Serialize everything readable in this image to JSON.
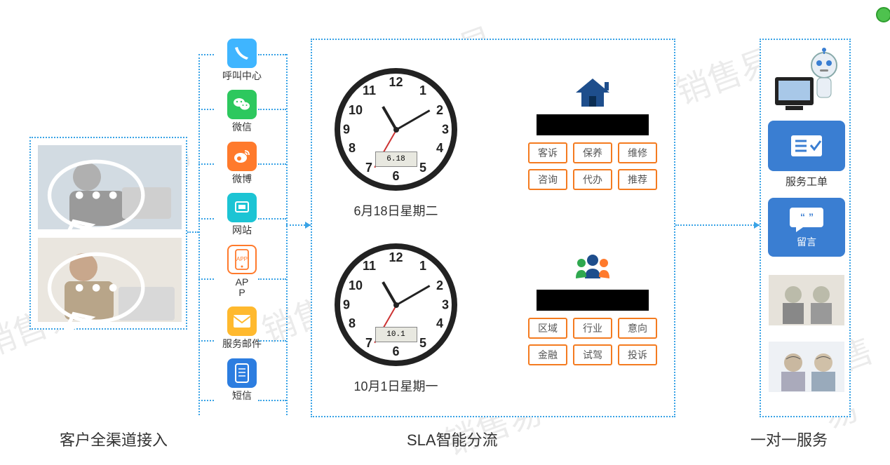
{
  "watermark_text": "销售易",
  "sections": {
    "left_title": "客户全渠道接入",
    "mid_title": "SLA智能分流",
    "right_title": "一对一服务"
  },
  "channels": [
    {
      "id": "call-center",
      "label": "呼叫中心",
      "icon": "phone",
      "color": "#3fb5ff"
    },
    {
      "id": "wechat",
      "label": "微信",
      "icon": "wechat",
      "color": "#2dc85e"
    },
    {
      "id": "weibo",
      "label": "微博",
      "icon": "weibo",
      "color": "#ff7a2c"
    },
    {
      "id": "website",
      "label": "网站",
      "icon": "website",
      "color": "#1cc4d4"
    },
    {
      "id": "app",
      "label": "AP\nP",
      "icon": "app",
      "color_border": "#ff7a2c"
    },
    {
      "id": "email",
      "label": "服务邮件",
      "icon": "mail",
      "color": "#ffb92e"
    },
    {
      "id": "sms",
      "label": "短信",
      "icon": "sms",
      "color": "#2c7de0"
    }
  ],
  "clocks": [
    {
      "caption": "6月18日星期二",
      "lcd": "6.18",
      "time": "10:10"
    },
    {
      "caption": "10月1日星期一",
      "lcd": "10.1",
      "time": "10:10"
    }
  ],
  "category_groups": [
    {
      "icon": "house",
      "tags_row1": [
        "客诉",
        "保养",
        "维修"
      ],
      "tags_row2": [
        "咨询",
        "代办",
        "推荐"
      ]
    },
    {
      "icon": "people",
      "tags_row1": [
        "区域",
        "行业",
        "意向"
      ],
      "tags_row2": [
        "金融",
        "试驾",
        "投诉"
      ]
    }
  ],
  "right_items": [
    {
      "type": "robot-photo"
    },
    {
      "type": "card",
      "icon": "form-check",
      "label": "服务工单"
    },
    {
      "type": "card",
      "icon": "message-quote",
      "inner_label": "留言"
    },
    {
      "type": "agent-photo-1"
    },
    {
      "type": "agent-photo-2"
    }
  ],
  "colors": {
    "dotted_border": "#39a3e6",
    "tag_border": "#f47b20",
    "card_bg": "#3a7ed2"
  }
}
